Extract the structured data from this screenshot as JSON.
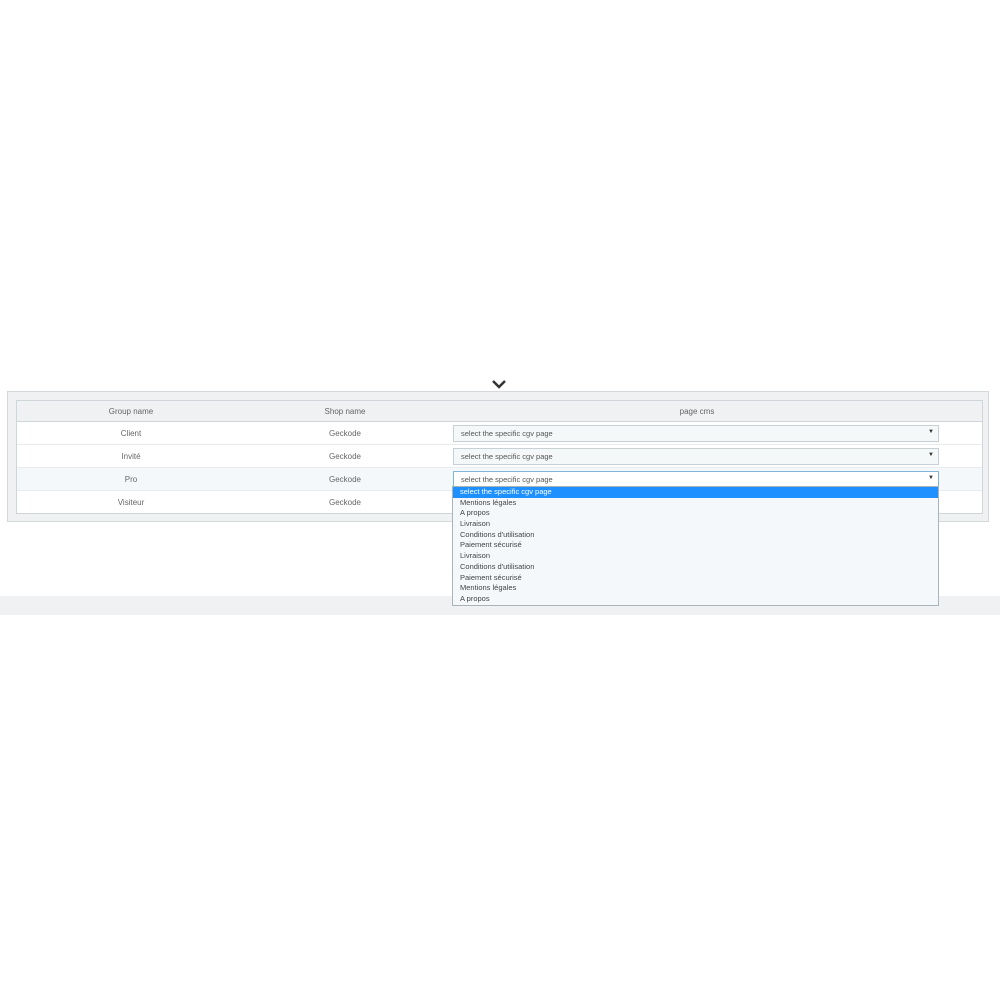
{
  "table": {
    "headers": {
      "group": "Group name",
      "shop": "Shop name",
      "page": "page cms"
    },
    "rows": [
      {
        "group": "Client",
        "shop": "Geckode",
        "select": "select the specific cgv page"
      },
      {
        "group": "Invité",
        "shop": "Geckode",
        "select": "select the specific cgv page"
      },
      {
        "group": "Pro",
        "shop": "Geckode",
        "select": "select the specific cgv page"
      },
      {
        "group": "Visiteur",
        "shop": "Geckode",
        "select": ""
      }
    ]
  },
  "dropdown": {
    "options": [
      "select the specific cgv page",
      "Mentions légales",
      "A propos",
      "Livraison",
      "Conditions d'utilisation",
      "Paiement sécurisé",
      "Livraison",
      "Conditions d'utilisation",
      "Paiement sécurisé",
      "Mentions légales",
      "A propos"
    ],
    "selected_index": 0
  },
  "icons": {
    "collapse": "chevron-down-icon",
    "select_arrow": "caret-down-icon"
  },
  "colors": {
    "selected_option": "#1e90ff",
    "panel_bg": "#eff1f2"
  }
}
